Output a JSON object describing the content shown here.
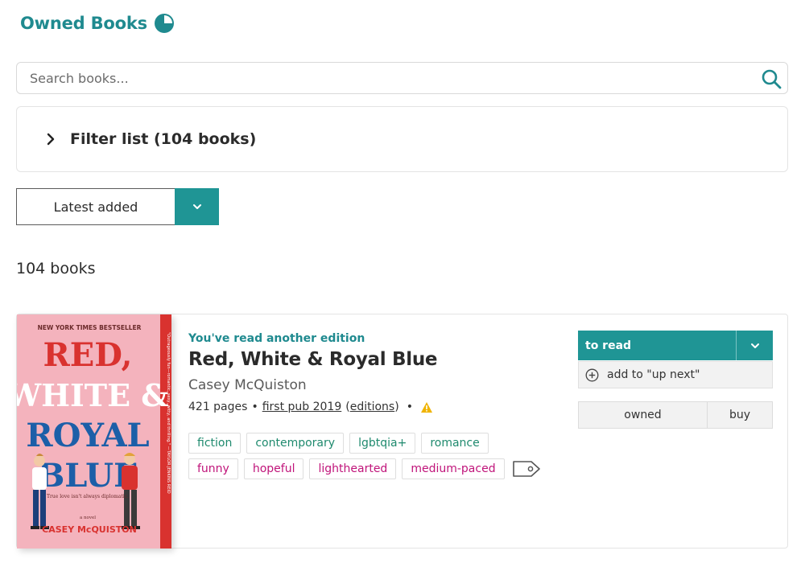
{
  "header": {
    "title": "Owned Books",
    "icon": "pie-chart-icon",
    "accent_color": "#1f8a8f"
  },
  "search": {
    "placeholder": "Search books...",
    "value": ""
  },
  "filter": {
    "label": "Filter list (104 books)"
  },
  "sort": {
    "label": "Latest added"
  },
  "results": {
    "count_label": "104 books"
  },
  "book": {
    "edition_note": "You've read another edition",
    "title": "Red, White & Royal Blue",
    "author": "Casey McQuiston",
    "pages": "421 pages",
    "bullet": "•",
    "first_pub": "first pub 2019",
    "edition_open": "(",
    "editions": "editions",
    "edition_close": ")",
    "genre_tags": [
      "fiction",
      "contemporary",
      "lgbtqia+",
      "romance"
    ],
    "mood_tags": [
      "funny",
      "hopeful",
      "lighthearted",
      "medium-paced"
    ],
    "status_label": "to read",
    "up_next_label": "add to \"up next\"",
    "owned_label": "owned",
    "buy_label": "buy",
    "cover": {
      "top_line": "NEW YORK TIMES BESTSELLER",
      "title_line1": "RED,",
      "title_line2": "WHITE &",
      "title_line3": "ROYAL",
      "title_line4": "BLUE",
      "tagline": "True love isn't always diplomatic.",
      "novel": "a novel",
      "author": "CASEY McQUISTON",
      "spine_quote": "\"Outrageously fun—romantic, sexy, witty, and thrilling.\" —TAYLOR JENKINS REID"
    }
  },
  "colors": {
    "teal": "#1f9595",
    "genre_text": "#1f8a6e",
    "mood_text": "#c0147a",
    "warning": "#f0b400"
  }
}
